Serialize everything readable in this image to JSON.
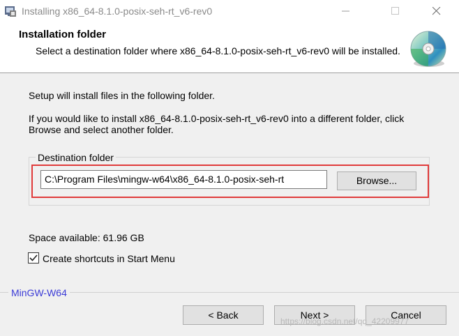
{
  "window": {
    "title": "Installing x86_64-8.1.0-posix-seh-rt_v6-rev0",
    "icons": [
      "installer-icon",
      "minimize-icon",
      "maximize-icon",
      "close-icon"
    ]
  },
  "header": {
    "title": "Installation folder",
    "subtitle": "Select a destination folder where x86_64-8.1.0-posix-seh-rt_v6-rev0 will be installed.",
    "icon": "cd-disc-icon"
  },
  "body": {
    "intro": "Setup will install files in the following folder.",
    "instructions": "If you would like to install x86_64-8.1.0-posix-seh-rt_v6-rev0 into a different folder, click Browse and select another folder."
  },
  "destination": {
    "group_label": "Destination folder",
    "path": "C:\\Program Files\\mingw-w64\\x86_64-8.1.0-posix-seh-rt",
    "browse_label": "Browse...",
    "highlight_color": "#e03a3a"
  },
  "space_available": "Space available: 61.96 GB",
  "shortcuts": {
    "label": "Create shortcuts in Start Menu",
    "checked": true
  },
  "footer": {
    "brand": "MinGW-W64",
    "brand_color": "#3b3bd6",
    "back_label": "< Back",
    "next_label": "Next >",
    "cancel_label": "Cancel"
  },
  "watermark": "https://blog.csdn.net/qq_42209977"
}
